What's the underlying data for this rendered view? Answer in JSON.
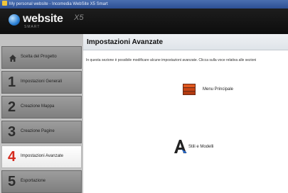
{
  "window": {
    "title": "My personal website - Incomedia WebSite X5 Smart"
  },
  "header": {
    "brand": "website",
    "version": "X5",
    "edition": "SMART"
  },
  "sidebar": {
    "items": [
      {
        "number": "",
        "label": "Scelta del Progetto",
        "icon": "home-icon",
        "active": false
      },
      {
        "number": "1",
        "label": "Impostazioni Generali",
        "active": false
      },
      {
        "number": "2",
        "label": "Creazione Mappa",
        "active": false
      },
      {
        "number": "3",
        "label": "Creazione Pagine",
        "active": false
      },
      {
        "number": "4",
        "label": "Impostazioni Avanzate",
        "active": true
      },
      {
        "number": "5",
        "label": "Esportazione",
        "active": false
      }
    ]
  },
  "main": {
    "title": "Impostazioni Avanzate",
    "description": "In questa sezione è possibile modificare alcune impostazioni avanzate. Clicca sulla voce relativa alle sezioni",
    "options": [
      {
        "label": "Menu Principale",
        "icon": "menu-icon"
      },
      {
        "label": "Stili e Modelli",
        "icon": "styles-icon"
      }
    ]
  },
  "colors": {
    "active_number": "#d62b1f",
    "header_bg": "#111111",
    "sidebar_bg": "#8a8a8a"
  }
}
